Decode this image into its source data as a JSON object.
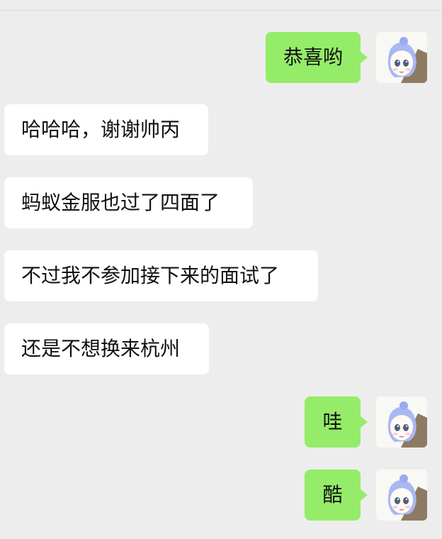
{
  "chat": {
    "messages": [
      {
        "side": "right",
        "text": "恭喜哟"
      },
      {
        "side": "left",
        "text": "哈哈哈，谢谢帅丙"
      },
      {
        "side": "left",
        "text": "蚂蚁金服也过了四面了"
      },
      {
        "side": "left",
        "text": "不过我不参加接下来的面试了"
      },
      {
        "side": "left",
        "text": "还是不想换来杭州"
      },
      {
        "side": "right",
        "text": "哇"
      },
      {
        "side": "right",
        "text": "酷"
      }
    ]
  },
  "avatar": {
    "icon": "anime-girl-avatar-icon",
    "hair_color": "#a9b8f2",
    "cloak_color": "#8e7a62"
  },
  "colors": {
    "background": "#ededed",
    "incoming_bubble": "#ffffff",
    "outgoing_bubble": "#95ec69",
    "text": "#111111"
  }
}
